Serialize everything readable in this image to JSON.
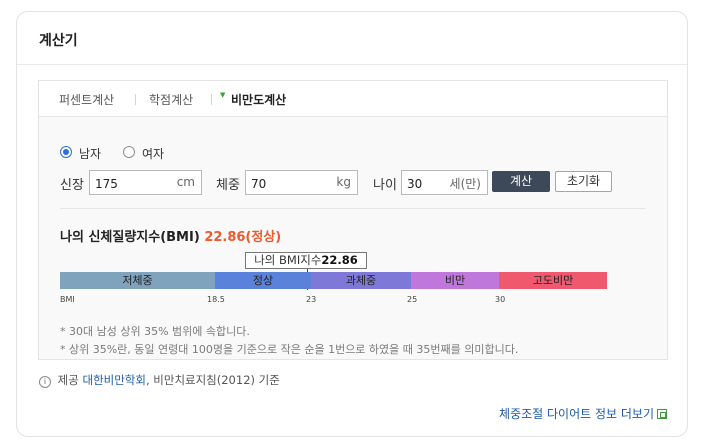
{
  "card": {
    "title": "계산기",
    "more_link": "체중조절 다이어트 정보 더보기"
  },
  "tabs": [
    {
      "label": "퍼센트계산",
      "active": false
    },
    {
      "label": "학점계산",
      "active": false
    },
    {
      "label": "비만도계산",
      "active": true
    }
  ],
  "gender": {
    "male": "남자",
    "female": "여자",
    "selected": "male"
  },
  "height": {
    "label": "신장",
    "value": "175",
    "unit": "cm"
  },
  "weight": {
    "label": "체중",
    "value": "70",
    "unit": "kg"
  },
  "age": {
    "label": "나이",
    "value": "30",
    "unit": "세(만)"
  },
  "buttons": {
    "calculate": "계산",
    "reset": "초기화"
  },
  "result": {
    "label": "나의 신체질량지수(BMI)",
    "value": "22.86(정상)"
  },
  "marker": {
    "label": "나의 BMI지수",
    "value": "22.86"
  },
  "bmi_scale": {
    "categories": [
      {
        "label": "저체중",
        "color": "#7fa3bd"
      },
      {
        "label": "정상",
        "color": "#5b82db"
      },
      {
        "label": "과체중",
        "color": "#7e79d8"
      },
      {
        "label": "비만",
        "color": "#c077dc"
      },
      {
        "label": "고도비만",
        "color": "#f0586d"
      }
    ],
    "ticks": [
      "BMI",
      "18.5",
      "23",
      "25",
      "30"
    ]
  },
  "notes": [
    "* 30대 남성 상위 35% 범위에 속합니다.",
    "* 상위 35%란, 동일 연령대 100명을 기준으로 작은 순을 1번으로 하였을 때 35번째를 의미합니다."
  ],
  "source": {
    "prefix": "제공",
    "provider": "대한비만학회",
    "suffix": ", 비만치료지침(2012) 기준"
  }
}
